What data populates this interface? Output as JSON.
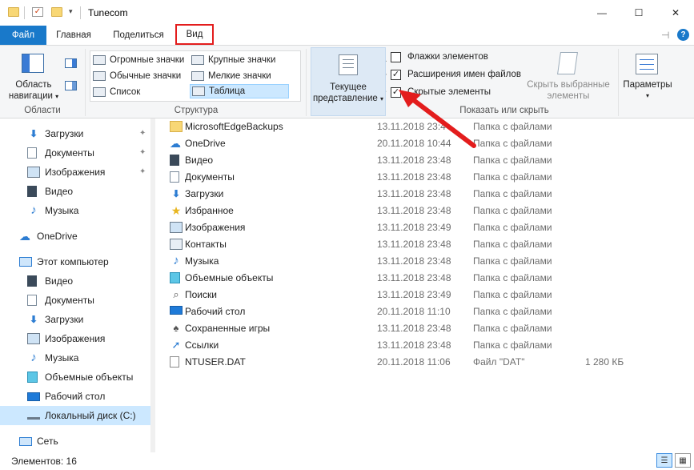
{
  "window": {
    "title": "Tunecom",
    "min": "—",
    "max": "☐",
    "close": "✕"
  },
  "tabs": {
    "file": "Файл",
    "home": "Главная",
    "share": "Поделиться",
    "view": "Вид",
    "help": "?"
  },
  "ribbon": {
    "panes": {
      "nav_label_1": "Область",
      "nav_label_2": "навигации",
      "group": "Области"
    },
    "layout": {
      "group": "Структура",
      "items": [
        "Огромные значки",
        "Крупные значки",
        "Обычные значки",
        "Мелкие значки",
        "Список",
        "Таблица"
      ],
      "selected": "Таблица"
    },
    "current_view": {
      "label_1": "Текущее",
      "label_2": "представление"
    },
    "show_hide": {
      "group": "Показать или скрыть",
      "item_checkboxes": {
        "label": "Флажки элементов",
        "checked": false
      },
      "file_extensions": {
        "label": "Расширения имен файлов",
        "checked": true
      },
      "hidden_items": {
        "label": "Скрытые элементы",
        "checked": true
      },
      "hide_selected_1": "Скрыть выбранные",
      "hide_selected_2": "элементы"
    },
    "options": {
      "label": "Параметры"
    }
  },
  "nav": {
    "quick": [
      {
        "label": "Загрузки",
        "icon": "download-icon"
      },
      {
        "label": "Документы",
        "icon": "document-icon"
      },
      {
        "label": "Изображения",
        "icon": "image-icon"
      },
      {
        "label": "Видео",
        "icon": "video-icon"
      },
      {
        "label": "Музыка",
        "icon": "music-icon"
      }
    ],
    "onedrive": "OneDrive",
    "this_pc": "Этот компьютер",
    "pc_items": [
      {
        "label": "Видео"
      },
      {
        "label": "Документы"
      },
      {
        "label": "Загрузки"
      },
      {
        "label": "Изображения"
      },
      {
        "label": "Музыка"
      },
      {
        "label": "Объемные объекты"
      },
      {
        "label": "Рабочий стол"
      },
      {
        "label": "Локальный диск (C:)"
      }
    ],
    "network": "Сеть"
  },
  "files": [
    {
      "name": "MicrosoftEdgeBackups",
      "date": "13.11.2018 23:4",
      "type": "Папка с файлами",
      "size": "",
      "icon": "folder-icon"
    },
    {
      "name": "OneDrive",
      "date": "20.11.2018 10:44",
      "type": "Папка с файлами",
      "size": "",
      "icon": "onedrive-icon"
    },
    {
      "name": "Видео",
      "date": "13.11.2018 23:48",
      "type": "Папка с файлами",
      "size": "",
      "icon": "video-icon"
    },
    {
      "name": "Документы",
      "date": "13.11.2018 23:48",
      "type": "Папка с файлами",
      "size": "",
      "icon": "document-icon"
    },
    {
      "name": "Загрузки",
      "date": "13.11.2018 23:48",
      "type": "Папка с файлами",
      "size": "",
      "icon": "download-icon"
    },
    {
      "name": "Избранное",
      "date": "13.11.2018 23:48",
      "type": "Папка с файлами",
      "size": "",
      "icon": "star-icon"
    },
    {
      "name": "Изображения",
      "date": "13.11.2018 23:49",
      "type": "Папка с файлами",
      "size": "",
      "icon": "image-icon"
    },
    {
      "name": "Контакты",
      "date": "13.11.2018 23:48",
      "type": "Папка с файлами",
      "size": "",
      "icon": "contacts-icon"
    },
    {
      "name": "Музыка",
      "date": "13.11.2018 23:48",
      "type": "Папка с файлами",
      "size": "",
      "icon": "music-icon"
    },
    {
      "name": "Объемные объекты",
      "date": "13.11.2018 23:48",
      "type": "Папка с файлами",
      "size": "",
      "icon": "cube-icon"
    },
    {
      "name": "Поиски",
      "date": "13.11.2018 23:49",
      "type": "Папка с файлами",
      "size": "",
      "icon": "search-icon"
    },
    {
      "name": "Рабочий стол",
      "date": "20.11.2018 11:10",
      "type": "Папка с файлами",
      "size": "",
      "icon": "desktop-icon"
    },
    {
      "name": "Сохраненные игры",
      "date": "13.11.2018 23:48",
      "type": "Папка с файлами",
      "size": "",
      "icon": "games-icon"
    },
    {
      "name": "Ссылки",
      "date": "13.11.2018 23:48",
      "type": "Папка с файлами",
      "size": "",
      "icon": "links-icon"
    },
    {
      "name": "NTUSER.DAT",
      "date": "20.11.2018 11:06",
      "type": "Файл \"DAT\"",
      "size": "1 280 КБ",
      "icon": "file-icon"
    }
  ],
  "status": {
    "count": "Элементов: 16"
  },
  "colors": {
    "accent": "#1979ca",
    "highlight": "#e31d1d",
    "selection": "#cce8ff"
  }
}
